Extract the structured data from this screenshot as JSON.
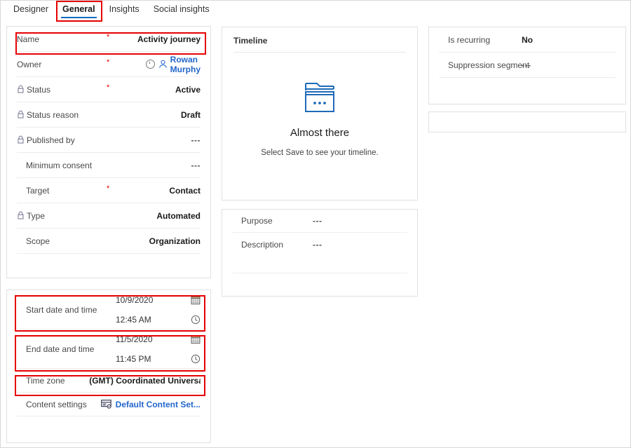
{
  "tabs": [
    {
      "label": "Designer",
      "selected": false,
      "highlighted": false
    },
    {
      "label": "General",
      "selected": true,
      "highlighted": true
    },
    {
      "label": "Insights",
      "selected": false,
      "highlighted": false
    },
    {
      "label": "Social insights",
      "selected": false,
      "highlighted": false
    }
  ],
  "main_card": {
    "fields": {
      "name": {
        "label": "Name",
        "value": "Activity journey",
        "required": "*",
        "highlighted": true
      },
      "owner": {
        "label": "Owner",
        "value": "Rowan Murphy",
        "required": "*"
      },
      "status": {
        "label": "Status",
        "value": "Active",
        "required": "*",
        "locked": true
      },
      "status_reason": {
        "label": "Status reason",
        "value": "Draft",
        "locked": true
      },
      "published_by": {
        "label": "Published by",
        "value": "---",
        "locked": true
      },
      "minimum_consent": {
        "label": "Minimum consent",
        "value": "---"
      },
      "target": {
        "label": "Target",
        "value": "Contact",
        "required": "*"
      },
      "type": {
        "label": "Type",
        "value": "Automated",
        "locked": true
      },
      "scope": {
        "label": "Scope",
        "value": "Organization"
      }
    }
  },
  "dates_card": {
    "start": {
      "label": "Start date and time",
      "date": "10/9/2020",
      "time": "12:45 AM",
      "highlighted": true
    },
    "end": {
      "label": "End date and time",
      "date": "11/5/2020",
      "time": "11:45 PM",
      "highlighted": true
    },
    "time_zone": {
      "label": "Time zone",
      "value": "(GMT) Coordinated Universal Time",
      "highlighted": true
    },
    "content_settings": {
      "label": "Content settings",
      "value": "Default Content Set..."
    }
  },
  "timeline_card": {
    "header": "Timeline",
    "empty_title": "Almost there",
    "empty_subtitle": "Select Save to see your timeline."
  },
  "purpose_card": {
    "purpose": {
      "label": "Purpose",
      "value": "---"
    },
    "description": {
      "label": "Description",
      "value": "---"
    }
  },
  "right_card": {
    "is_recurring": {
      "label": "Is recurring",
      "value": "No"
    },
    "suppression_segment": {
      "label": "Suppression segment",
      "value": "---"
    }
  },
  "colors": {
    "highlight": "#e60000",
    "accent": "#0f6cbd",
    "link": "#2266cc",
    "required": "#e10000",
    "label_text": "#494949"
  }
}
